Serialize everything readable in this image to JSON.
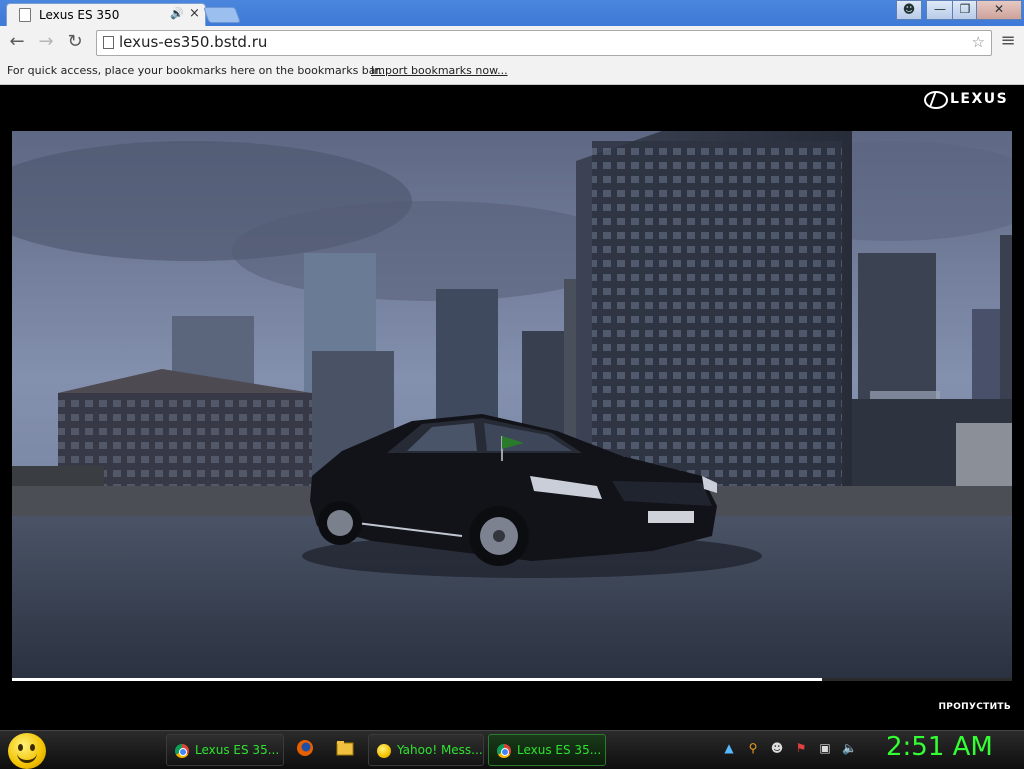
{
  "browser": {
    "tab": {
      "title": "Lexus ES 350"
    },
    "address_bar": {
      "url": "lexus-es350.bstd.ru"
    },
    "bookmarks_bar": {
      "message": "For quick access, place your bookmarks here on the bookmarks bar.",
      "import_link": "Import bookmarks now..."
    }
  },
  "page": {
    "brand_logo_text": "LEXUS",
    "video": {
      "progress": 0.81
    },
    "skip_label": "ПРОПУСТИТЬ"
  },
  "taskbar": {
    "buttons": [
      {
        "label": "Lexus ES 35...",
        "icon": "chrome-icon"
      },
      {
        "label": "Yahoo! Mess...",
        "icon": "yahoo-messenger-icon"
      },
      {
        "label": "Lexus ES 35...",
        "icon": "chrome-icon",
        "active": true
      }
    ],
    "clock": "2:51 AM"
  },
  "colors": {
    "titlebar": "#4a86dd",
    "taskbar_text": "#2fe32f",
    "clock": "#33ff33"
  }
}
